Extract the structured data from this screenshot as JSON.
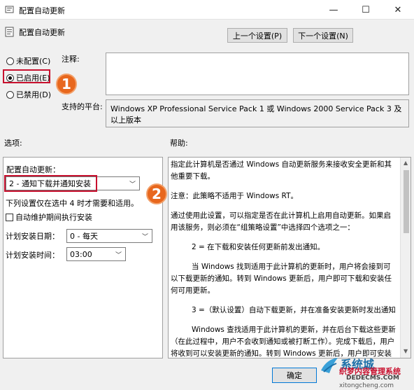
{
  "window": {
    "title": "配置自动更新",
    "controls": {
      "minimize": "—",
      "maximize": "☐",
      "close": "✕"
    }
  },
  "header": {
    "policy_name": "配置自动更新",
    "prev_button": "上一个设置(P)",
    "next_button": "下一个设置(N)"
  },
  "state_options": [
    {
      "label": "未配置(C)",
      "selected": false
    },
    {
      "label": "已启用(E)",
      "selected": true
    },
    {
      "label": "已禁用(D)",
      "selected": false
    }
  ],
  "comment": {
    "label": "注释:",
    "value": ""
  },
  "platform": {
    "label": "支持的平台:",
    "value": "Windows XP Professional Service Pack 1 或 Windows 2000 Service Pack 3 及以上版本"
  },
  "options": {
    "section_label": "选项:",
    "config_label": "配置自动更新：",
    "config_value": "2 - 通知下载并通知安装",
    "note": "下列设置仅在选中 4 时才需要和适用。",
    "maintenance_checkbox": {
      "label": "自动维护期间执行安装",
      "checked": false
    },
    "day_label": "计划安装日期：",
    "day_value": "0 - 每天",
    "time_label": "计划安装时间：",
    "time_value": "03:00"
  },
  "help": {
    "section_label": "帮助:",
    "paragraphs": [
      "指定此计算机是否通过 Windows 自动更新服务来接收安全更新和其他重要下载。",
      "注意：此策略不适用于 Windows RT。",
      "通过使用此设置，可以指定是否在此计算机上启用自动更新。如果启用该服务，则必须在“组策略设置”中选择四个选项之一：",
      "2 = 在下载和安装任何更新前发出通知。",
      "当 Windows 找到适用于此计算机的更新时，用户将会接到可以下载更新的通知。转到 Windows 更新后，用户即可下载和安装任何可用更新。",
      "3 =（默认设置）自动下载更新，并在准备安装更新时发出通知",
      "Windows 查找适用于此计算机的更新，并在后台下载这些更新（在此过程中，用户不会收到通知或被打断工作）。完成下载后，用户将收到可以安装更新的通知。转到 Windows 更新后，用户即可安装更新。"
    ]
  },
  "footer": {
    "ok_button": "确定"
  },
  "annotations": {
    "badge1": "1",
    "badge2": "2"
  },
  "watermark": {
    "logo_text": "系统城",
    "line1": "织梦内容管理系统",
    "line2": "DEDECMS.COM",
    "line3": "xitongcheng.com"
  },
  "colors": {
    "highlight_red": "#c8102e",
    "badge_orange": "#e8671d"
  }
}
